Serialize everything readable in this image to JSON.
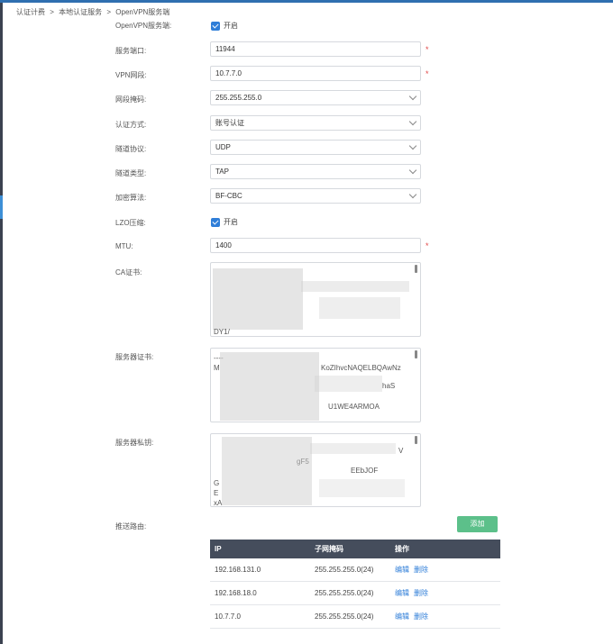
{
  "breadcrumb": [
    "认证计费",
    ">",
    "本地认证服务",
    ">",
    "OpenVPN服务端"
  ],
  "form": {
    "openvpn_label": "OpenVPN服务端:",
    "openvpn_check": "开启",
    "port_label": "服务端口:",
    "port_value": "11944",
    "vpn_net_label": "VPN网段:",
    "vpn_net_value": "10.7.7.0",
    "mask_label": "网段掩码:",
    "mask_value": "255.255.255.0",
    "auth_label": "认证方式:",
    "auth_value": "账号认证",
    "proto_label": "隧道协议:",
    "proto_value": "UDP",
    "tun_label": "隧道类型:",
    "tun_value": "TAP",
    "cipher_label": "加密算法:",
    "cipher_value": "BF-CBC",
    "lzo_label": "LZO压缩:",
    "lzo_check": "开启",
    "mtu_label": "MTU:",
    "mtu_value": "1400",
    "required_mark": "*",
    "ca_label": "CA证书:",
    "ca_visible_text": "DY1/",
    "server_cert_label": "服务器证书:",
    "server_cert_line1": "----",
    "server_cert_line2": "M",
    "server_cert_line3": "KoZIhvcNAQELBQAwNz",
    "server_cert_line4": "haS",
    "server_cert_line5": "U1WE4ARMOA",
    "server_key_label": "服务器私钥:",
    "server_key_line1": "V",
    "server_key_line2": "gF5",
    "server_key_line3": "EEbJOF",
    "server_key_line4": "G",
    "server_key_line5": "E",
    "server_key_line6": "xA",
    "push_label": "推送路由:"
  },
  "buttons": {
    "add": "添加"
  },
  "table": {
    "headers": [
      "IP",
      "子网掩码",
      "操作"
    ],
    "rows": [
      {
        "ip": "192.168.131.0",
        "mask": "255.255.255.0(24)",
        "edit": "编辑",
        "delete": "删除"
      },
      {
        "ip": "192.168.18.0",
        "mask": "255.255.255.0(24)",
        "edit": "编辑",
        "delete": "删除"
      },
      {
        "ip": "10.7.7.0",
        "mask": "255.255.255.0(24)",
        "edit": "编辑",
        "delete": "删除"
      }
    ]
  },
  "colors": {
    "accent": "#2f7ed8",
    "add_button": "#5cc08a",
    "table_header": "#454d5c",
    "required": "#e04848"
  }
}
